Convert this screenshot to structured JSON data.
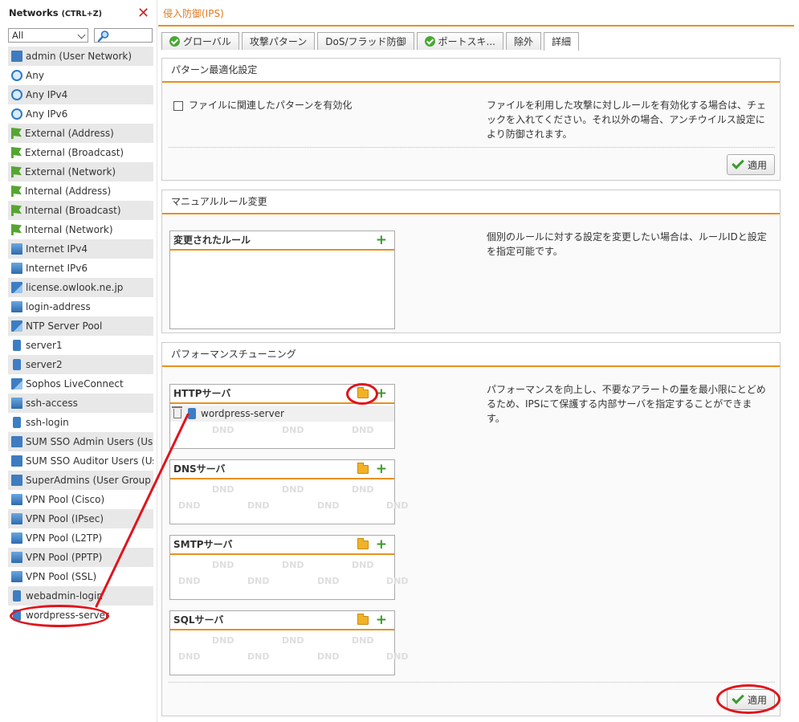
{
  "sidebar": {
    "title": "Networks",
    "shortcut": "(CTRL+Z)",
    "filter_value": "All",
    "items": [
      {
        "label": "admin (User Network)",
        "icon": "user-network-icon"
      },
      {
        "label": "Any",
        "icon": "globe-icon"
      },
      {
        "label": "Any IPv4",
        "icon": "globe-icon"
      },
      {
        "label": "Any IPv6",
        "icon": "globe-icon"
      },
      {
        "label": "External (Address)",
        "icon": "interface-flag-icon"
      },
      {
        "label": "External (Broadcast)",
        "icon": "interface-flag-icon"
      },
      {
        "label": "External (Network)",
        "icon": "interface-flag-icon"
      },
      {
        "label": "Internal (Address)",
        "icon": "interface-flag-icon"
      },
      {
        "label": "Internal (Broadcast)",
        "icon": "interface-flag-icon"
      },
      {
        "label": "Internal (Network)",
        "icon": "interface-flag-icon"
      },
      {
        "label": "Internet IPv4",
        "icon": "network-icon"
      },
      {
        "label": "Internet IPv6",
        "icon": "network-icon"
      },
      {
        "label": "license.owlook.ne.jp",
        "icon": "dns-host-icon"
      },
      {
        "label": "login-address",
        "icon": "network-icon"
      },
      {
        "label": "NTP Server Pool",
        "icon": "dns-group-icon"
      },
      {
        "label": "server1",
        "icon": "host-icon"
      },
      {
        "label": "server2",
        "icon": "host-icon"
      },
      {
        "label": "Sophos LiveConnect",
        "icon": "dns-host-icon"
      },
      {
        "label": "ssh-access",
        "icon": "network-icon"
      },
      {
        "label": "ssh-login",
        "icon": "host-icon"
      },
      {
        "label": "SUM SSO Admin Users (User",
        "icon": "user-network-icon"
      },
      {
        "label": "SUM SSO Auditor Users (User",
        "icon": "user-network-icon"
      },
      {
        "label": "SuperAdmins (User Group Net",
        "icon": "user-network-icon"
      },
      {
        "label": "VPN Pool (Cisco)",
        "icon": "network-icon"
      },
      {
        "label": "VPN Pool (IPsec)",
        "icon": "network-icon"
      },
      {
        "label": "VPN Pool (L2TP)",
        "icon": "network-icon"
      },
      {
        "label": "VPN Pool (PPTP)",
        "icon": "network-icon"
      },
      {
        "label": "VPN Pool (SSL)",
        "icon": "network-icon"
      },
      {
        "label": "webadmin-login",
        "icon": "host-icon"
      },
      {
        "label": "wordpress-server",
        "icon": "host-icon"
      }
    ]
  },
  "main": {
    "breadcrumb": "侵入防御(IPS)",
    "tabs": [
      {
        "label": "グローバル",
        "status": "enabled"
      },
      {
        "label": "攻撃パターン"
      },
      {
        "label": "DoS/フラッド防御"
      },
      {
        "label": "ポートスキ...",
        "status": "enabled"
      },
      {
        "label": "除外"
      },
      {
        "label": "詳細",
        "active": true
      }
    ],
    "pattern_opt": {
      "title": "パターン最適化設定",
      "checkbox_label": "ファイルに関連したパターンを有効化",
      "checked": false,
      "description": [
        "ファイルを利用した攻撃に対しルールを有効化する場合は、チェ",
        "ックを入れてください。それ以外の場合、アンチウイルス設定に",
        "より防御されます。"
      ],
      "apply_label": "適用"
    },
    "manual_rules": {
      "title": "マニュアルルール変更",
      "box_title": "変更されたルール",
      "description": [
        "個別のルールに対する設定を変更したい場合は、ルールIDと設定",
        "を指定可能です。"
      ]
    },
    "perf": {
      "title": "パフォーマンスチューニング",
      "description": [
        "パフォーマンスを向上し、不要なアラートの量を最小限にとどめ",
        "るため、IPSにて保護する内部サーバを指定することができま",
        "す。"
      ],
      "boxes": [
        {
          "title": "HTTPサーバ",
          "entries": [
            "wordpress-server"
          ]
        },
        {
          "title": "DNSサーバ",
          "entries": []
        },
        {
          "title": "SMTPサーバ",
          "entries": []
        },
        {
          "title": "SQLサーバ",
          "entries": []
        }
      ],
      "dnd_label": "DND",
      "apply_label": "適用"
    }
  },
  "colors": {
    "accent": "#e8901e",
    "annotation": "#e0141c",
    "check": "#48a833"
  }
}
